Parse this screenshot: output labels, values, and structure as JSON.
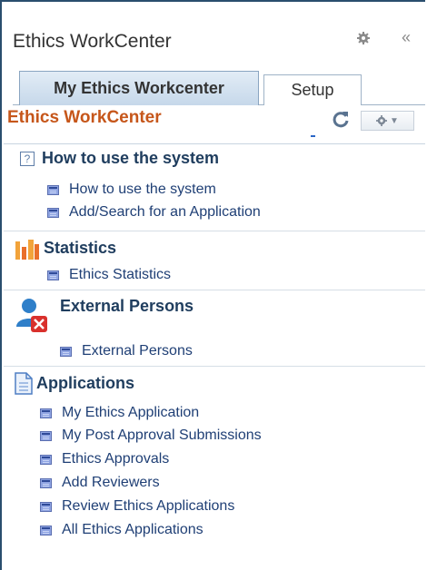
{
  "header": {
    "title": "Ethics WorkCenter",
    "collapse_glyph": "«"
  },
  "tabs": [
    {
      "label": "My Ethics Workcenter",
      "active": true
    },
    {
      "label": "Setup",
      "active": false
    }
  ],
  "pagelet": {
    "title": "Ethics WorkCenter",
    "options_caret": "▼"
  },
  "sections": [
    {
      "icon": "help-icon",
      "title": "How to use the system",
      "links": [
        "How to use the system",
        "Add/Search for an Application"
      ]
    },
    {
      "icon": "bar-chart-icon",
      "title": "Statistics",
      "links": [
        "Ethics Statistics"
      ]
    },
    {
      "icon": "person-remove-icon",
      "title": "External Persons",
      "links": [
        "External Persons"
      ]
    },
    {
      "icon": "document-icon",
      "title": "Applications",
      "links": [
        "My Ethics Application",
        "My Post Approval Submissions",
        "Ethics Approvals",
        "Add Reviewers",
        "Review Ethics Applications",
        "All Ethics Applications"
      ]
    }
  ],
  "colors": {
    "frame": "#2a4e6e",
    "pagelet_title": "#c6561a",
    "link": "#1f3f75",
    "section_title": "#1f3d5e"
  }
}
